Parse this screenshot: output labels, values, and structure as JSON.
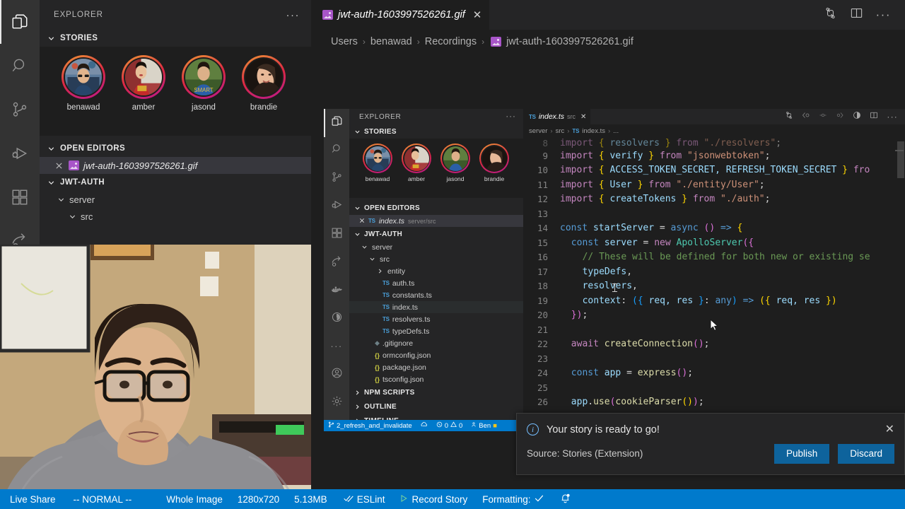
{
  "outer": {
    "activity_bar": [
      {
        "name": "explorer",
        "icon": "files-icon",
        "active": true
      },
      {
        "name": "search",
        "icon": "search-icon",
        "active": false
      },
      {
        "name": "source-control",
        "icon": "source-control-icon",
        "active": false
      },
      {
        "name": "run-and-debug",
        "icon": "run-debug-icon",
        "active": false
      },
      {
        "name": "extensions",
        "icon": "extensions-icon",
        "active": false
      },
      {
        "name": "live-share",
        "icon": "live-share-icon",
        "active": false
      }
    ],
    "sidebar": {
      "title": "EXPLORER",
      "more_actions": "···",
      "stories": {
        "header": "STORIES",
        "items": [
          {
            "name": "benawad"
          },
          {
            "name": "amber"
          },
          {
            "name": "jasond"
          },
          {
            "name": "brandie"
          }
        ]
      },
      "open_editors": {
        "header": "OPEN EDITORS",
        "items": [
          {
            "label": "jwt-auth-1603997526261.gif",
            "icon": "gif-file-icon",
            "close": "✕"
          }
        ]
      },
      "project": {
        "header": "JWT-AUTH",
        "items": [
          {
            "label": "server",
            "indent": 1,
            "expanded": true
          },
          {
            "label": "src",
            "indent": 2,
            "expanded": true
          }
        ]
      }
    },
    "tab": {
      "label": "jwt-auth-1603997526261.gif",
      "icon": "gif-file-icon",
      "close": "✕"
    },
    "tab_actions": [
      "split-editor-icon",
      "layout-icon",
      "more-actions-icon"
    ],
    "breadcrumb": {
      "separator": "›",
      "items": [
        "Users",
        "benawad",
        "Recordings",
        "jwt-auth-1603997526261.gif"
      ]
    },
    "status_bar": {
      "items": [
        {
          "label": "Live Share",
          "icon": ""
        },
        {
          "label": "-- NORMAL --",
          "icon": ""
        },
        {
          "label": "Whole Image",
          "icon": ""
        },
        {
          "label": "1280x720",
          "icon": ""
        },
        {
          "label": "5.13MB",
          "icon": ""
        },
        {
          "label": "ESLint",
          "icon": "check-check-icon"
        },
        {
          "label": "Record Story",
          "icon": "play-icon"
        },
        {
          "label": "Formatting:",
          "icon": "check-icon"
        },
        {
          "label": "",
          "icon": "bell-dot-icon"
        }
      ]
    }
  },
  "inner": {
    "activity_bar": [
      {
        "name": "explorer",
        "icon": "files-icon",
        "active": true
      },
      {
        "name": "search",
        "icon": "search-icon",
        "active": false
      },
      {
        "name": "source-control",
        "icon": "source-control-icon",
        "active": false
      },
      {
        "name": "run-and-debug",
        "icon": "run-debug-icon",
        "active": false
      },
      {
        "name": "extensions",
        "icon": "extensions-icon",
        "active": false
      },
      {
        "name": "live-share",
        "icon": "live-share-icon",
        "active": false
      },
      {
        "name": "docker",
        "icon": "docker-icon",
        "active": false
      },
      {
        "name": "test-explorer",
        "icon": "beaker-clock-icon",
        "active": false
      },
      {
        "name": "more-views",
        "icon": "more-icon",
        "active": false
      },
      {
        "name": "accounts",
        "icon": "account-icon",
        "active": false
      },
      {
        "name": "manage",
        "icon": "gear-icon",
        "active": false
      }
    ],
    "sidebar": {
      "title": "EXPLORER",
      "more_actions": "···",
      "stories": {
        "header": "STORIES",
        "items": [
          {
            "name": "benawad"
          },
          {
            "name": "amber"
          },
          {
            "name": "jasond"
          },
          {
            "name": "brandie"
          }
        ]
      },
      "open_editors": {
        "header": "OPEN EDITORS",
        "items": [
          {
            "label": "index.ts",
            "detail": "server/src",
            "icon": "ts-file-icon",
            "close": "✕"
          }
        ]
      },
      "project": {
        "header": "JWT-AUTH",
        "items": [
          {
            "label": "server",
            "indent": 1,
            "icon": "folder-open",
            "kind": "folder"
          },
          {
            "label": "src",
            "indent": 2,
            "icon": "folder-open",
            "kind": "folder"
          },
          {
            "label": "entity",
            "indent": 3,
            "icon": "folder-closed",
            "kind": "folder"
          },
          {
            "label": "auth.ts",
            "indent": 3,
            "icon": "ts-file-icon",
            "kind": "file"
          },
          {
            "label": "constants.ts",
            "indent": 3,
            "icon": "ts-file-icon",
            "kind": "file"
          },
          {
            "label": "index.ts",
            "indent": 3,
            "icon": "ts-file-icon",
            "kind": "file",
            "selected": true
          },
          {
            "label": "resolvers.ts",
            "indent": 3,
            "icon": "ts-file-icon",
            "kind": "file"
          },
          {
            "label": "typeDefs.ts",
            "indent": 3,
            "icon": "ts-file-icon",
            "kind": "file"
          },
          {
            "label": ".gitignore",
            "indent": 2,
            "icon": "git-file-icon",
            "kind": "file"
          },
          {
            "label": "ormconfig.json",
            "indent": 2,
            "icon": "json-file-icon",
            "kind": "file"
          },
          {
            "label": "package.json",
            "indent": 2,
            "icon": "json-file-icon",
            "kind": "file"
          },
          {
            "label": "tsconfig.json",
            "indent": 2,
            "icon": "json-file-icon",
            "kind": "file"
          }
        ]
      },
      "collapsed_sections": [
        "NPM SCRIPTS",
        "OUTLINE",
        "TIMELINE"
      ]
    },
    "tab": {
      "label": "index.ts",
      "detail": "src",
      "icon": "ts-file-icon",
      "close": "✕"
    },
    "tab_actions": [
      "split-editor-icon",
      "go-back-icon",
      "diff-prev-icon",
      "diff-next-icon",
      "coverage-icon",
      "split-layout-icon",
      "more-actions-icon"
    ],
    "breadcrumb": {
      "separator": "›",
      "items": [
        "server",
        "src",
        "index.ts",
        "..."
      ]
    },
    "code": {
      "language": "typescript",
      "lines": [
        {
          "num": "8",
          "tokens": [
            {
              "t": "import",
              "c": "kw"
            },
            {
              "t": " ",
              "c": "pl"
            },
            {
              "t": "{",
              "c": "br"
            },
            {
              "t": " resolvers ",
              "c": "id"
            },
            {
              "t": "}",
              "c": "br"
            },
            {
              "t": " ",
              "c": "pl"
            },
            {
              "t": "from",
              "c": "kw"
            },
            {
              "t": " ",
              "c": "pl"
            },
            {
              "t": "\"./resolvers\"",
              "c": "str"
            },
            {
              "t": ";",
              "c": "pl"
            }
          ],
          "indent": 0,
          "partial": true
        },
        {
          "num": "9",
          "tokens": [
            {
              "t": "import",
              "c": "kw"
            },
            {
              "t": " ",
              "c": "pl"
            },
            {
              "t": "{",
              "c": "br"
            },
            {
              "t": " verify ",
              "c": "id"
            },
            {
              "t": "}",
              "c": "br"
            },
            {
              "t": " ",
              "c": "pl"
            },
            {
              "t": "from",
              "c": "kw"
            },
            {
              "t": " ",
              "c": "pl"
            },
            {
              "t": "\"jsonwebtoken\"",
              "c": "str"
            },
            {
              "t": ";",
              "c": "pl"
            }
          ],
          "indent": 0
        },
        {
          "num": "10",
          "tokens": [
            {
              "t": "import",
              "c": "kw"
            },
            {
              "t": " ",
              "c": "pl"
            },
            {
              "t": "{",
              "c": "br"
            },
            {
              "t": " ACCESS_TOKEN_SECRET, REFRESH_TOKEN_SECRET ",
              "c": "id"
            },
            {
              "t": "}",
              "c": "br"
            },
            {
              "t": " ",
              "c": "pl"
            },
            {
              "t": "fro",
              "c": "kw"
            }
          ],
          "indent": 0
        },
        {
          "num": "11",
          "tokens": [
            {
              "t": "import",
              "c": "kw"
            },
            {
              "t": " ",
              "c": "pl"
            },
            {
              "t": "{",
              "c": "br"
            },
            {
              "t": " User ",
              "c": "id"
            },
            {
              "t": "}",
              "c": "br"
            },
            {
              "t": " ",
              "c": "pl"
            },
            {
              "t": "from",
              "c": "kw"
            },
            {
              "t": " ",
              "c": "pl"
            },
            {
              "t": "\"./entity/User\"",
              "c": "str"
            },
            {
              "t": ";",
              "c": "pl"
            }
          ],
          "indent": 0
        },
        {
          "num": "12",
          "tokens": [
            {
              "t": "import",
              "c": "kw"
            },
            {
              "t": " ",
              "c": "pl"
            },
            {
              "t": "{",
              "c": "br"
            },
            {
              "t": " createTokens ",
              "c": "id"
            },
            {
              "t": "}",
              "c": "br"
            },
            {
              "t": " ",
              "c": "pl"
            },
            {
              "t": "from",
              "c": "kw"
            },
            {
              "t": " ",
              "c": "pl"
            },
            {
              "t": "\"./auth\"",
              "c": "str"
            },
            {
              "t": ";",
              "c": "pl"
            }
          ],
          "indent": 0
        },
        {
          "num": "13",
          "tokens": [],
          "indent": 0
        },
        {
          "num": "14",
          "tokens": [
            {
              "t": "const",
              "c": "kw2"
            },
            {
              "t": " ",
              "c": "pl"
            },
            {
              "t": "startServer",
              "c": "id"
            },
            {
              "t": " = ",
              "c": "pl"
            },
            {
              "t": "async",
              "c": "kw2"
            },
            {
              "t": " ",
              "c": "pl"
            },
            {
              "t": "()",
              "c": "br2"
            },
            {
              "t": " ",
              "c": "pl"
            },
            {
              "t": "=>",
              "c": "kw2"
            },
            {
              "t": " ",
              "c": "pl"
            },
            {
              "t": "{",
              "c": "br"
            }
          ],
          "indent": 0
        },
        {
          "num": "15",
          "tokens": [
            {
              "t": "const",
              "c": "kw2"
            },
            {
              "t": " ",
              "c": "pl"
            },
            {
              "t": "server",
              "c": "id"
            },
            {
              "t": " = ",
              "c": "pl"
            },
            {
              "t": "new",
              "c": "kw"
            },
            {
              "t": " ",
              "c": "pl"
            },
            {
              "t": "ApolloServer",
              "c": "ty"
            },
            {
              "t": "({",
              "c": "br2"
            }
          ],
          "indent": 1
        },
        {
          "num": "16",
          "tokens": [
            {
              "t": "// These will be defined for both new or existing se",
              "c": "cm"
            }
          ],
          "indent": 2
        },
        {
          "num": "17",
          "tokens": [
            {
              "t": "typeDefs",
              "c": "id"
            },
            {
              "t": ",",
              "c": "pl"
            }
          ],
          "indent": 2
        },
        {
          "num": "18",
          "tokens": [
            {
              "t": "resolvers",
              "c": "id"
            },
            {
              "t": ",",
              "c": "pl"
            }
          ],
          "indent": 2
        },
        {
          "num": "19",
          "tokens": [
            {
              "t": "context",
              "c": "id"
            },
            {
              "t": ": ",
              "c": "pl"
            },
            {
              "t": "({",
              "c": "br3"
            },
            {
              "t": " req, res ",
              "c": "id"
            },
            {
              "t": "}",
              "c": "br3"
            },
            {
              "t": ": ",
              "c": "pl"
            },
            {
              "t": "any",
              "c": "kw2"
            },
            {
              "t": ")",
              "c": "br3"
            },
            {
              "t": " ",
              "c": "pl"
            },
            {
              "t": "=>",
              "c": "kw2"
            },
            {
              "t": " ",
              "c": "pl"
            },
            {
              "t": "({",
              "c": "br"
            },
            {
              "t": " req, res ",
              "c": "id"
            },
            {
              "t": "})",
              "c": "br"
            }
          ],
          "indent": 2
        },
        {
          "num": "20",
          "tokens": [
            {
              "t": "})",
              "c": "br2"
            },
            {
              "t": ";",
              "c": "pl"
            }
          ],
          "indent": 1
        },
        {
          "num": "21",
          "tokens": [],
          "indent": 0
        },
        {
          "num": "22",
          "tokens": [
            {
              "t": "await",
              "c": "kw"
            },
            {
              "t": " ",
              "c": "pl"
            },
            {
              "t": "createConnection",
              "c": "fn"
            },
            {
              "t": "()",
              "c": "br2"
            },
            {
              "t": ";",
              "c": "pl"
            }
          ],
          "indent": 1
        },
        {
          "num": "23",
          "tokens": [],
          "indent": 0
        },
        {
          "num": "24",
          "tokens": [
            {
              "t": "const",
              "c": "kw2"
            },
            {
              "t": " ",
              "c": "pl"
            },
            {
              "t": "app",
              "c": "id"
            },
            {
              "t": " = ",
              "c": "pl"
            },
            {
              "t": "express",
              "c": "fn"
            },
            {
              "t": "()",
              "c": "br2"
            },
            {
              "t": ";",
              "c": "pl"
            }
          ],
          "indent": 1
        },
        {
          "num": "25",
          "tokens": [],
          "indent": 0
        },
        {
          "num": "26",
          "tokens": [
            {
              "t": "app",
              "c": "id"
            },
            {
              "t": ".",
              "c": "pl"
            },
            {
              "t": "use",
              "c": "fn"
            },
            {
              "t": "(",
              "c": "br2"
            },
            {
              "t": "cookieParser",
              "c": "fn"
            },
            {
              "t": "()",
              "c": "br"
            },
            {
              "t": ")",
              "c": "br2"
            },
            {
              "t": ";",
              "c": "pl"
            }
          ],
          "indent": 1
        }
      ]
    },
    "status_bar": {
      "branch": "2_refresh_and_invalidate",
      "sync_icon": "sync-cloud-icon",
      "errors": "0",
      "warnings": "0",
      "user": "Ben"
    }
  },
  "notification": {
    "icon": "info-icon",
    "message": "Your story is ready to go!",
    "close": "✕",
    "source": "Source: Stories (Extension)",
    "buttons": [
      {
        "label": "Publish",
        "primary": true
      },
      {
        "label": "Discard",
        "primary": true
      }
    ]
  },
  "colors": {
    "accent": "#007acc",
    "button": "#0e639c",
    "sidebar_bg": "#252526",
    "editor_bg": "#1e1e1e",
    "activity_bg": "#333333",
    "selection": "#37373d",
    "story_ring_start": "#f09433",
    "story_ring_end": "#bc1888"
  }
}
